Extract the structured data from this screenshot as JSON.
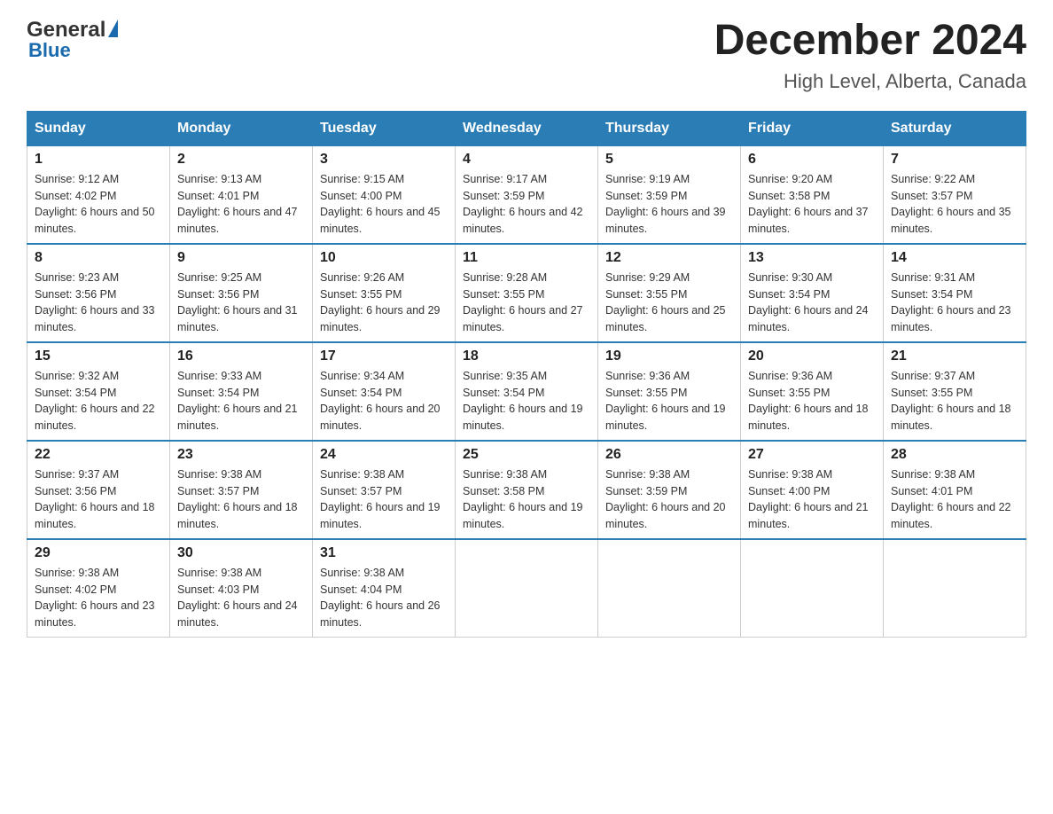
{
  "header": {
    "logo_general": "General",
    "logo_blue": "Blue",
    "month_title": "December 2024",
    "location": "High Level, Alberta, Canada"
  },
  "days_of_week": [
    "Sunday",
    "Monday",
    "Tuesday",
    "Wednesday",
    "Thursday",
    "Friday",
    "Saturday"
  ],
  "weeks": [
    [
      {
        "day": "1",
        "sunrise": "9:12 AM",
        "sunset": "4:02 PM",
        "daylight": "6 hours and 50 minutes."
      },
      {
        "day": "2",
        "sunrise": "9:13 AM",
        "sunset": "4:01 PM",
        "daylight": "6 hours and 47 minutes."
      },
      {
        "day": "3",
        "sunrise": "9:15 AM",
        "sunset": "4:00 PM",
        "daylight": "6 hours and 45 minutes."
      },
      {
        "day": "4",
        "sunrise": "9:17 AM",
        "sunset": "3:59 PM",
        "daylight": "6 hours and 42 minutes."
      },
      {
        "day": "5",
        "sunrise": "9:19 AM",
        "sunset": "3:59 PM",
        "daylight": "6 hours and 39 minutes."
      },
      {
        "day": "6",
        "sunrise": "9:20 AM",
        "sunset": "3:58 PM",
        "daylight": "6 hours and 37 minutes."
      },
      {
        "day": "7",
        "sunrise": "9:22 AM",
        "sunset": "3:57 PM",
        "daylight": "6 hours and 35 minutes."
      }
    ],
    [
      {
        "day": "8",
        "sunrise": "9:23 AM",
        "sunset": "3:56 PM",
        "daylight": "6 hours and 33 minutes."
      },
      {
        "day": "9",
        "sunrise": "9:25 AM",
        "sunset": "3:56 PM",
        "daylight": "6 hours and 31 minutes."
      },
      {
        "day": "10",
        "sunrise": "9:26 AM",
        "sunset": "3:55 PM",
        "daylight": "6 hours and 29 minutes."
      },
      {
        "day": "11",
        "sunrise": "9:28 AM",
        "sunset": "3:55 PM",
        "daylight": "6 hours and 27 minutes."
      },
      {
        "day": "12",
        "sunrise": "9:29 AM",
        "sunset": "3:55 PM",
        "daylight": "6 hours and 25 minutes."
      },
      {
        "day": "13",
        "sunrise": "9:30 AM",
        "sunset": "3:54 PM",
        "daylight": "6 hours and 24 minutes."
      },
      {
        "day": "14",
        "sunrise": "9:31 AM",
        "sunset": "3:54 PM",
        "daylight": "6 hours and 23 minutes."
      }
    ],
    [
      {
        "day": "15",
        "sunrise": "9:32 AM",
        "sunset": "3:54 PM",
        "daylight": "6 hours and 22 minutes."
      },
      {
        "day": "16",
        "sunrise": "9:33 AM",
        "sunset": "3:54 PM",
        "daylight": "6 hours and 21 minutes."
      },
      {
        "day": "17",
        "sunrise": "9:34 AM",
        "sunset": "3:54 PM",
        "daylight": "6 hours and 20 minutes."
      },
      {
        "day": "18",
        "sunrise": "9:35 AM",
        "sunset": "3:54 PM",
        "daylight": "6 hours and 19 minutes."
      },
      {
        "day": "19",
        "sunrise": "9:36 AM",
        "sunset": "3:55 PM",
        "daylight": "6 hours and 19 minutes."
      },
      {
        "day": "20",
        "sunrise": "9:36 AM",
        "sunset": "3:55 PM",
        "daylight": "6 hours and 18 minutes."
      },
      {
        "day": "21",
        "sunrise": "9:37 AM",
        "sunset": "3:55 PM",
        "daylight": "6 hours and 18 minutes."
      }
    ],
    [
      {
        "day": "22",
        "sunrise": "9:37 AM",
        "sunset": "3:56 PM",
        "daylight": "6 hours and 18 minutes."
      },
      {
        "day": "23",
        "sunrise": "9:38 AM",
        "sunset": "3:57 PM",
        "daylight": "6 hours and 18 minutes."
      },
      {
        "day": "24",
        "sunrise": "9:38 AM",
        "sunset": "3:57 PM",
        "daylight": "6 hours and 19 minutes."
      },
      {
        "day": "25",
        "sunrise": "9:38 AM",
        "sunset": "3:58 PM",
        "daylight": "6 hours and 19 minutes."
      },
      {
        "day": "26",
        "sunrise": "9:38 AM",
        "sunset": "3:59 PM",
        "daylight": "6 hours and 20 minutes."
      },
      {
        "day": "27",
        "sunrise": "9:38 AM",
        "sunset": "4:00 PM",
        "daylight": "6 hours and 21 minutes."
      },
      {
        "day": "28",
        "sunrise": "9:38 AM",
        "sunset": "4:01 PM",
        "daylight": "6 hours and 22 minutes."
      }
    ],
    [
      {
        "day": "29",
        "sunrise": "9:38 AM",
        "sunset": "4:02 PM",
        "daylight": "6 hours and 23 minutes."
      },
      {
        "day": "30",
        "sunrise": "9:38 AM",
        "sunset": "4:03 PM",
        "daylight": "6 hours and 24 minutes."
      },
      {
        "day": "31",
        "sunrise": "9:38 AM",
        "sunset": "4:04 PM",
        "daylight": "6 hours and 26 minutes."
      },
      null,
      null,
      null,
      null
    ]
  ]
}
